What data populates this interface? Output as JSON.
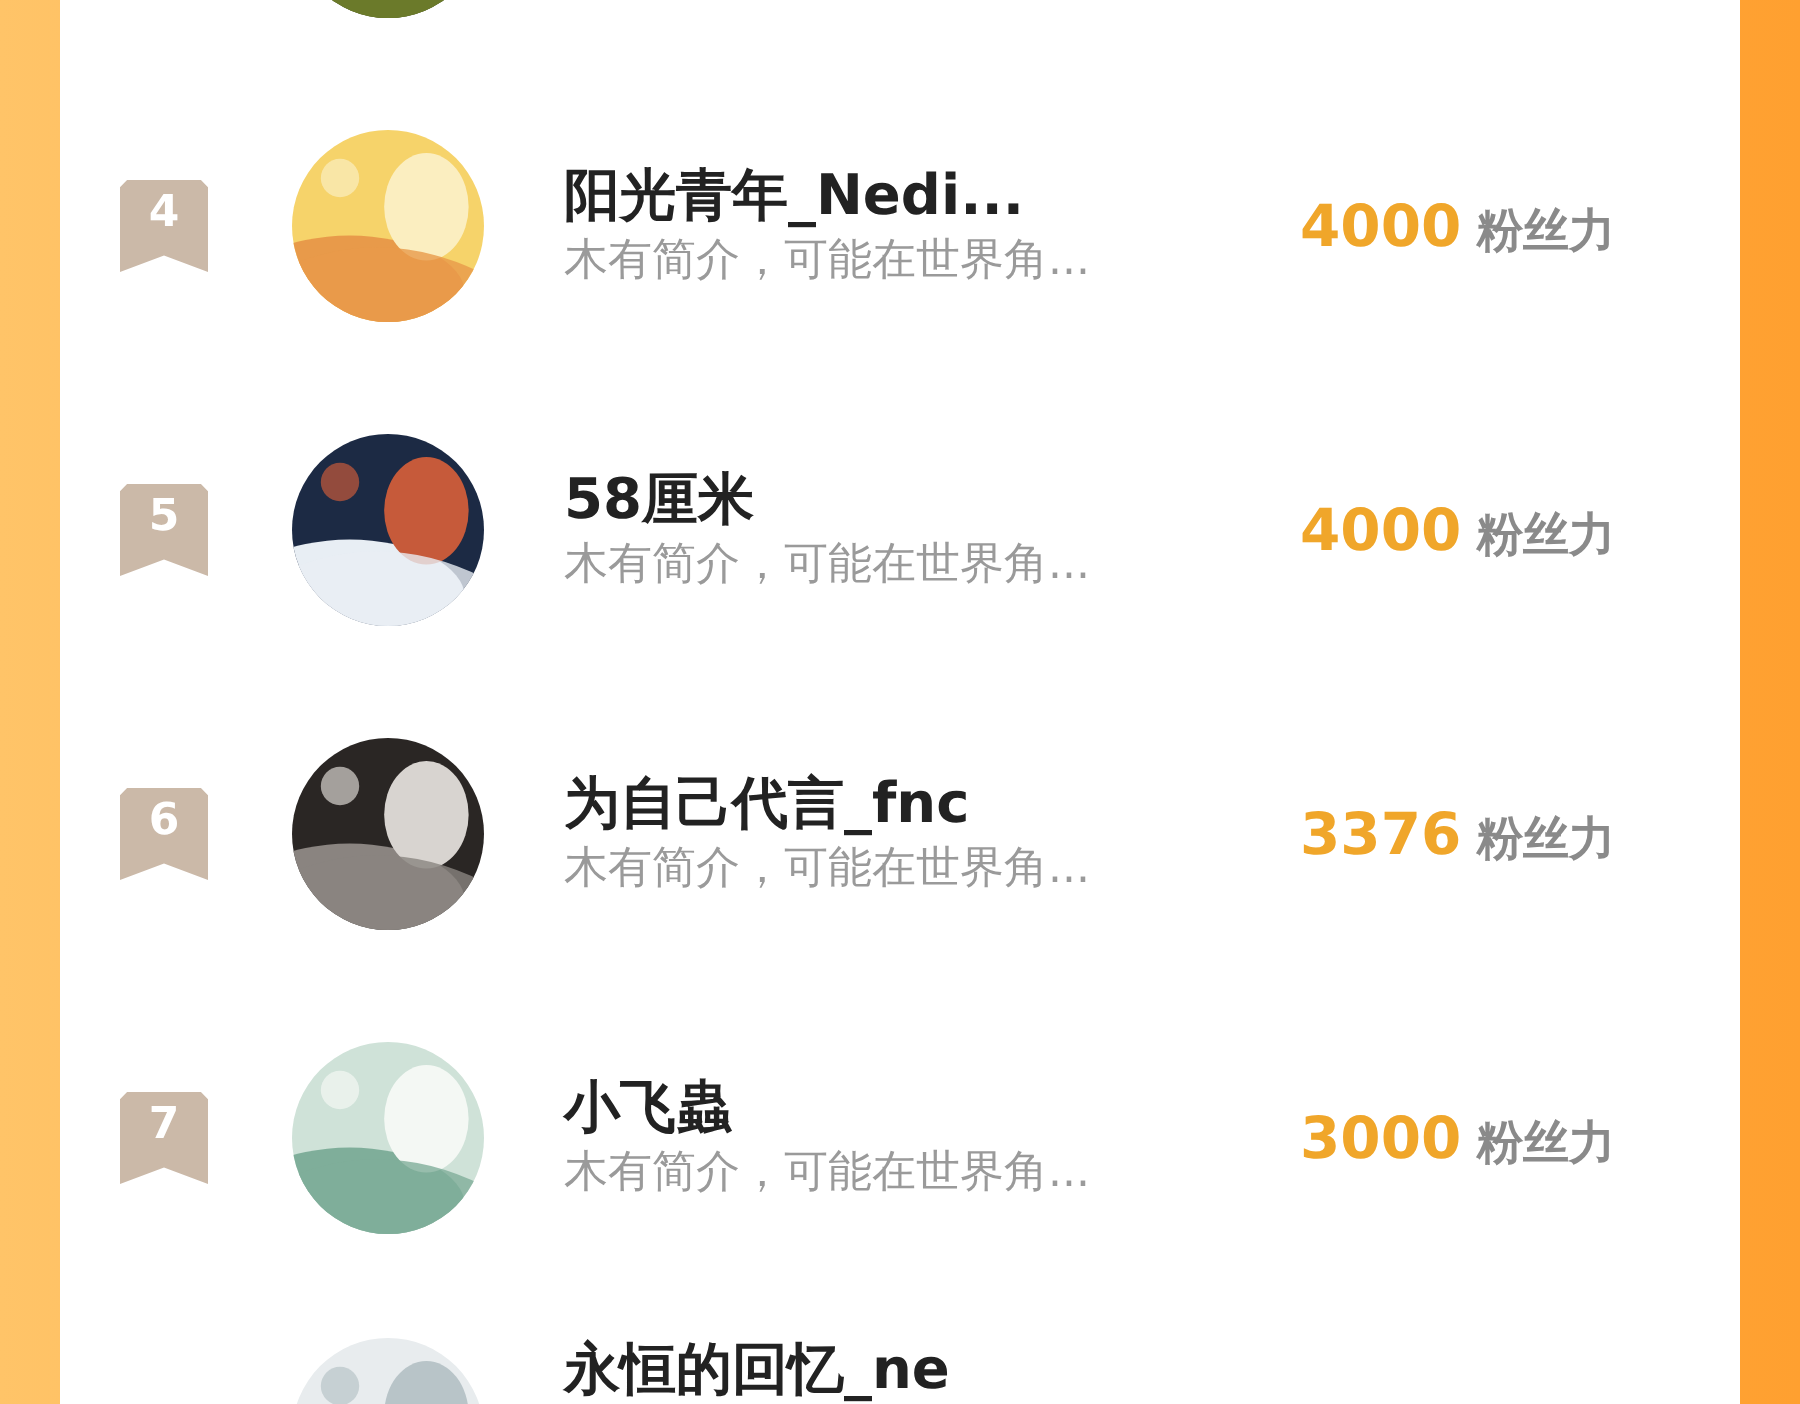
{
  "ranking": [
    {
      "kind": "cut-top"
    },
    {
      "kind": "full",
      "rank": "4",
      "name": "阳光青年_Nedi...",
      "intro": "木有简介，可能在世界角...",
      "score": "4000",
      "score_unit": "粉丝力"
    },
    {
      "kind": "full",
      "rank": "5",
      "name": "58厘米",
      "intro": "木有简介，可能在世界角...",
      "score": "4000",
      "score_unit": "粉丝力"
    },
    {
      "kind": "full",
      "rank": "6",
      "name": "为自己代言_fnc",
      "intro": "木有简介，可能在世界角...",
      "score": "3376",
      "score_unit": "粉丝力"
    },
    {
      "kind": "full",
      "rank": "7",
      "name": "小飞蟲",
      "intro": "木有简介，可能在世界角...",
      "score": "3000",
      "score_unit": "粉丝力"
    },
    {
      "kind": "cut-bottom",
      "name": "永恒的回忆_ne"
    }
  ]
}
